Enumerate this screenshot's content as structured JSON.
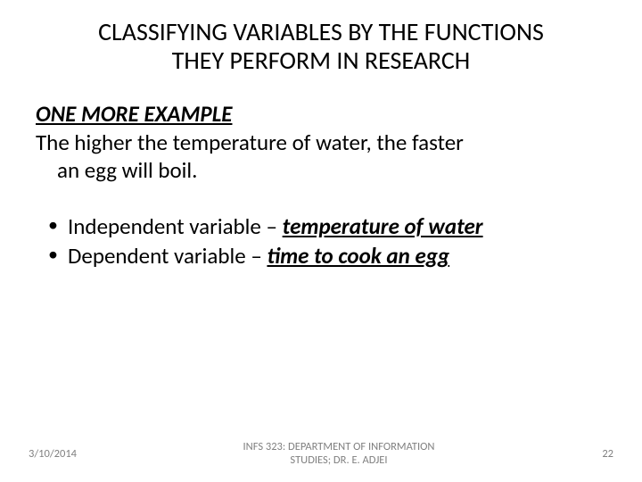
{
  "slide": {
    "title_line1": "CLASSIFYING VARIABLES BY THE FUNCTIONS",
    "title_line2": "THEY PERFORM IN RESEARCH",
    "example_heading": "ONE MORE EXAMPLE",
    "example_text_line1": "The higher the temperature of water, the faster",
    "example_text_line2": "an egg will boil.",
    "bullets": [
      {
        "label": "Independent variable – ",
        "emph": "temperature of water"
      },
      {
        "label": "Dependent variable – ",
        "emph": "time to cook an egg"
      }
    ]
  },
  "footer": {
    "date": "3/10/2014",
    "course_line1": "INFS 323: DEPARTMENT OF INFORMATION",
    "course_line2": "STUDIES; DR. E. ADJEI",
    "page_number": "22"
  }
}
